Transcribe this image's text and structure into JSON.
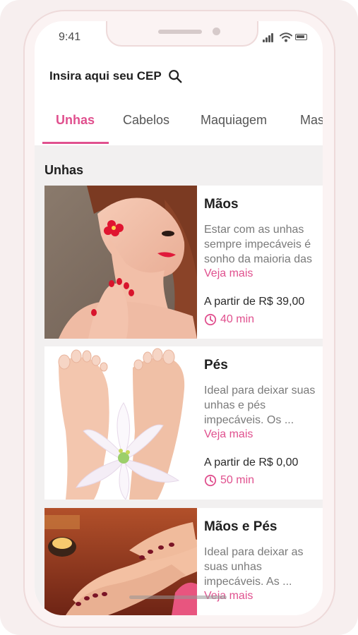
{
  "status_bar": {
    "time": "9:41"
  },
  "header": {
    "cep_label": "Insira aqui seu CEP"
  },
  "tabs": [
    {
      "label": "Unhas",
      "active": true
    },
    {
      "label": "Cabelos",
      "active": false
    },
    {
      "label": "Maquiagem",
      "active": false
    },
    {
      "label": "Mas",
      "active": false
    }
  ],
  "section": {
    "title": "Unhas"
  },
  "services": [
    {
      "title": "Mãos",
      "desc_lines": [
        "Estar com as unhas",
        "sempre impecáveis é",
        "sonho da maioria das"
      ],
      "more": "Veja mais",
      "price": "A partir de R$ 39,00",
      "duration": "40 min"
    },
    {
      "title": "Pés",
      "desc_lines": [
        "Ideal para deixar suas",
        "unhas e pés",
        "impecáveis. Os ..."
      ],
      "more": "Veja mais",
      "price": "A partir de R$ 0,00",
      "duration": "50 min"
    },
    {
      "title": "Mãos e Pés",
      "desc_lines": [
        "Ideal para deixar as",
        "suas unhas",
        "impecáveis. As ..."
      ],
      "more": "Veja mais"
    }
  ],
  "colors": {
    "accent": "#e0508e",
    "background": "#f2f0f0",
    "frame": "#fbf3f3"
  },
  "icons": {
    "search": "search-icon",
    "clock": "clock-icon",
    "signal": "signal-icon",
    "wifi": "wifi-icon",
    "battery": "battery-icon"
  }
}
